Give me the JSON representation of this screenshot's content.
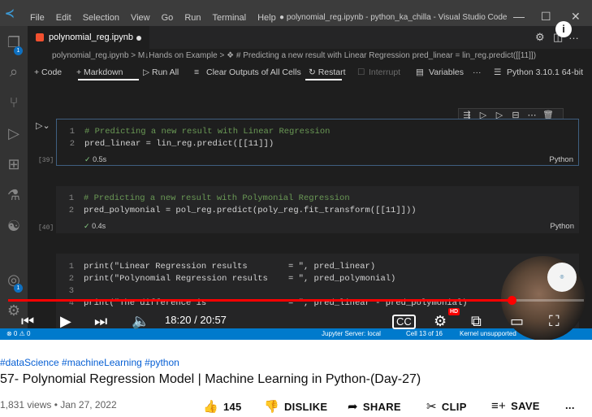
{
  "titlebar": {
    "menu": [
      "File",
      "Edit",
      "Selection",
      "View",
      "Go",
      "Run",
      "Terminal",
      "Help"
    ],
    "window_title": "● polynomial_reg.ipynb - python_ka_chilla - Visual Studio Code"
  },
  "tab": {
    "label": "polynomial_reg.ipynb"
  },
  "breadcrumb": "polynomial_reg.ipynb > M↓Hands on Example > ❖ # Predicting a new result with Linear Regression pred_linear = lin_reg.predict([[11]])",
  "toolbar": {
    "code": "+ Code",
    "markdown": "+ Markdown",
    "run_all": "▷ Run All",
    "clear": "Clear Outputs of All Cells",
    "restart": "↻ Restart",
    "interrupt": "Interrupt",
    "variables": "Variables",
    "more": "···",
    "kernel": "Python 3.10.1 64-bit"
  },
  "cells": [
    {
      "exec": "[39]",
      "time": "0.5s",
      "lang": "Python",
      "lines": [
        {
          "n": "1",
          "text": "# Predicting a new result with Linear Regression"
        },
        {
          "n": "2",
          "text": "pred_linear = lin_reg.predict([[11]])"
        }
      ]
    },
    {
      "exec": "[40]",
      "time": "0.4s",
      "lang": "Python",
      "lines": [
        {
          "n": "1",
          "text": "# Predicting a new result with Polymonial Regression"
        },
        {
          "n": "2",
          "text": "pred_polymonial = pol_reg.predict(poly_reg.fit_transform([[11]]))"
        }
      ]
    },
    {
      "lines": [
        {
          "n": "1",
          "text": "print(\"Linear Regression results        = \", pred_linear)"
        },
        {
          "n": "2",
          "text": "print(\"Polynomial Regression results    = \", pred_polymonial)"
        },
        {
          "n": "3",
          "text": ""
        },
        {
          "n": "4",
          "text": "print(\"The difference is                = \", pred_linear - pred_polymonial)"
        }
      ]
    }
  ],
  "statusbar": {
    "left": "⊗ 0 ⚠ 0",
    "server": "Jupyter Server: local",
    "cell": "Cell 13 of 16",
    "trust": "Kernel unsupported"
  },
  "player": {
    "time": "18:20 / 20:57",
    "progress": 0.875,
    "hd": "HD"
  },
  "video_info": {
    "tags": "#dataScience #machineLearning #python",
    "title": "57- Polynomial Regression Model | Machine Learning in Python-(Day-27)",
    "meta": "1,831 views • Jan 27, 2022",
    "likes": "145",
    "dislike": "DISLIKE",
    "share": "SHARE",
    "clip": "CLIP",
    "save": "SAVE",
    "more": "..."
  },
  "colors": {
    "accent": "#ff0000",
    "vscode_blue": "#007acc",
    "link": "#065fd4"
  }
}
